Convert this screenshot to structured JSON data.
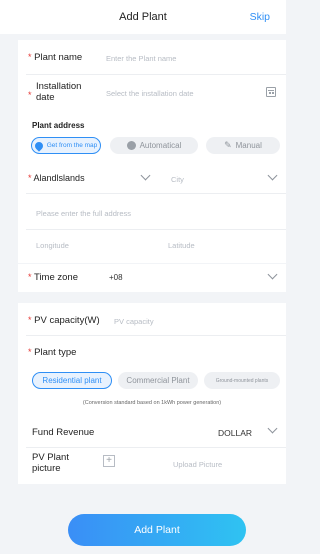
{
  "header": {
    "title": "Add Plant",
    "skip": "Skip"
  },
  "plant_name": {
    "label": "Plant name",
    "placeholder": "Enter the Plant name"
  },
  "installation_date": {
    "label_line1": "Installation",
    "label_line2": "date",
    "placeholder": "Select the installation date",
    "icon": "calendar-icon"
  },
  "plant_address": {
    "heading": "Plant address",
    "options": [
      {
        "label": "Get from the map",
        "icon": "location-pin-icon",
        "selected": true
      },
      {
        "label": "Automatical",
        "icon": "auto-icon",
        "selected": false
      },
      {
        "label": "Manual",
        "icon": "pencil-icon",
        "selected": false
      }
    ],
    "region": {
      "value": "Alandlslands",
      "city_placeholder": "City"
    },
    "full_address_placeholder": "Please enter the full address",
    "longitude_placeholder": "Longitude",
    "latitude_placeholder": "Latitude"
  },
  "time_zone": {
    "label": "Time zone",
    "value": "+08"
  },
  "pv_capacity": {
    "label": "PV capacity(W)",
    "placeholder": "PV capacity"
  },
  "plant_type": {
    "label": "Plant type",
    "options": [
      {
        "label": "Residential plant",
        "selected": true
      },
      {
        "label": "Commercial Plant",
        "selected": false
      },
      {
        "label": "Ground-mounted plants",
        "selected": false
      }
    ],
    "note": "(Conversion standard based on 1kWh power generation)"
  },
  "fund_revenue": {
    "label": "Fund Revenue",
    "value": "DOLLAR"
  },
  "pv_picture": {
    "label_line1": "PV Plant",
    "label_line2": "picture",
    "upload": "Upload Picture"
  },
  "submit": {
    "label": "Add Plant"
  },
  "colors": {
    "accent": "#2f8ff5",
    "required": "#e53935",
    "background": "#f2f4f7"
  }
}
